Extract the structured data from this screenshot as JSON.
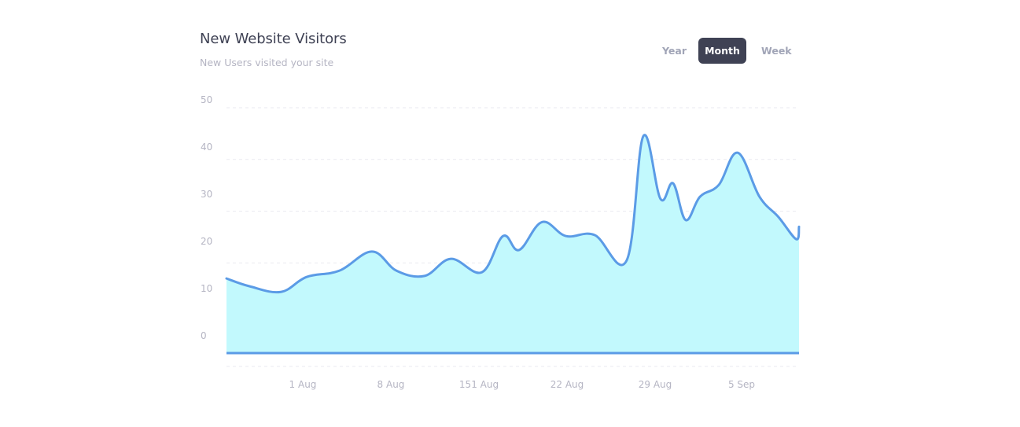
{
  "header": {
    "title": "New Website Visitors",
    "subtitle": "New Users visited your site"
  },
  "toggles": [
    {
      "label": "Year",
      "active": false
    },
    {
      "label": "Month",
      "active": true
    },
    {
      "label": "Week",
      "active": false
    }
  ],
  "colors": {
    "line": "#5b9be6",
    "fill": "#c2f9fd",
    "grid": "#eaeaf0",
    "active_toggle": "#3f4254"
  },
  "chart_data": {
    "type": "area",
    "title": "New Website Visitors",
    "subtitle": "New Users visited your site",
    "xlabel": "",
    "ylabel": "",
    "ylim": [
      0,
      50
    ],
    "yticks": [
      0,
      10,
      20,
      30,
      40,
      50
    ],
    "ytick_labels": [
      "0",
      "10",
      "20",
      "30",
      "40",
      "50"
    ],
    "xtick_labels": [
      "1 Aug",
      "8 Aug",
      "151 Aug",
      "22 Aug",
      "29 Aug",
      "5 Sep"
    ],
    "grid": true,
    "legend": "none",
    "series": [
      {
        "name": "New Users",
        "x": [
          0,
          0.04,
          0.095,
          0.14,
          0.197,
          0.254,
          0.297,
          0.346,
          0.392,
          0.446,
          0.483,
          0.511,
          0.551,
          0.593,
          0.643,
          0.699,
          0.728,
          0.758,
          0.78,
          0.802,
          0.827,
          0.86,
          0.893,
          0.931,
          0.964,
          0.995,
          1.0
        ],
        "values": [
          17,
          15.5,
          14.4,
          17.3,
          18.5,
          22.2,
          18.5,
          17.5,
          20.8,
          18.2,
          25.2,
          22.5,
          27.9,
          25.2,
          25.4,
          20.5,
          44.5,
          32.4,
          35.4,
          28.3,
          32.8,
          35.1,
          41.3,
          32.8,
          28.9,
          24.6,
          27.0
        ]
      }
    ]
  }
}
